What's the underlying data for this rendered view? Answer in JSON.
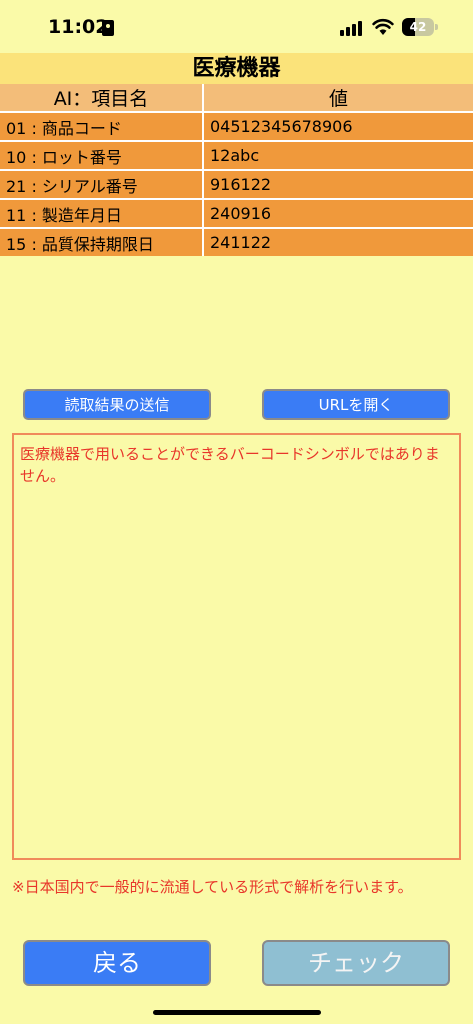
{
  "status": {
    "time": "11:02",
    "battery": "42",
    "battery_level": 0.42
  },
  "header": {
    "title": "医療機器"
  },
  "table": {
    "headers": [
      "AI：項目名",
      "値"
    ],
    "rows": [
      [
        "01 : 商品コード",
        "04512345678906"
      ],
      [
        "10 : ロット番号",
        "12abc"
      ],
      [
        "21 : シリアル番号",
        "916122"
      ],
      [
        "11 : 製造年月日",
        "240916"
      ],
      [
        "15 : 品質保持期限日",
        "241122"
      ]
    ]
  },
  "actions": {
    "send_label": "読取結果の送信",
    "open_url_label": "URLを開く"
  },
  "message": {
    "text": "医療機器で用いることができるバーコードシンボルではありません。"
  },
  "note": {
    "text": "※日本国内で一般的に流通している形式で解析を行います。"
  },
  "footer": {
    "back_label": "戻る",
    "check_label": "チェック"
  },
  "colors": {
    "primary_button": "#3a7cf5",
    "disabled_button": "#8fbfd2",
    "error_text": "#e8362a"
  }
}
